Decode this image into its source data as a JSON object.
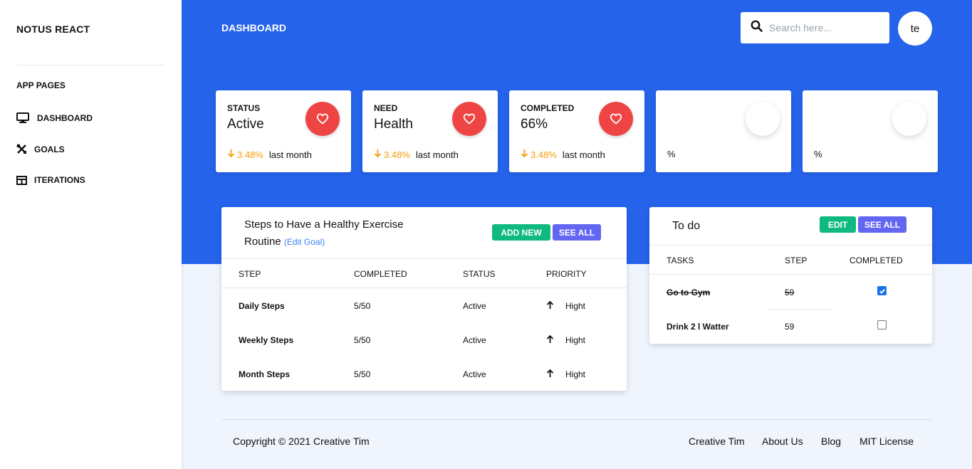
{
  "sidebar": {
    "brand": "NOTUS REACT",
    "heading": "APP PAGES",
    "items": [
      {
        "label": "DASHBOARD",
        "icon": "monitor-icon"
      },
      {
        "label": "GOALS",
        "icon": "tools-icon"
      },
      {
        "label": "ITERATIONS",
        "icon": "table-icon"
      }
    ]
  },
  "header": {
    "title": "DASHBOARD",
    "search_placeholder": "Search here...",
    "avatar_text": "te"
  },
  "stats": [
    {
      "label": "STATUS",
      "value": "Active",
      "change": "3.48%",
      "since": "last month",
      "icon": "heart-icon"
    },
    {
      "label": "NEED",
      "value": "Health",
      "change": "3.48%",
      "since": "last month",
      "icon": "heart-icon"
    },
    {
      "label": "COMPLETED",
      "value": "66%",
      "change": "3.48%",
      "since": "last month",
      "icon": "heart-icon"
    },
    {
      "footer": "%"
    },
    {
      "footer": "%"
    }
  ],
  "goal": {
    "title": "Steps to Have a Healthy Exercise Routine",
    "edit_link": "(Edit Goal)",
    "add_new": "ADD NEW",
    "see_all": "SEE ALL",
    "columns": [
      "STEP",
      "COMPLETED",
      "STATUS",
      "PRIORITY"
    ],
    "rows": [
      {
        "step": "Daily Steps",
        "completed": "5/50",
        "status": "Active",
        "priority": "Hight"
      },
      {
        "step": "Weekly Steps",
        "completed": "5/50",
        "status": "Active",
        "priority": "Hight"
      },
      {
        "step": "Month Steps",
        "completed": "5/50",
        "status": "Active",
        "priority": "Hight"
      }
    ]
  },
  "todo": {
    "title": "To do",
    "edit": "EDIT",
    "see_all": "SEE ALL",
    "columns": [
      "TASKS",
      "STEP",
      "COMPLETED"
    ],
    "rows": [
      {
        "task": "Go to Gym",
        "step": "59",
        "completed": true
      },
      {
        "task": "Drink 2 l Watter",
        "step": "59",
        "completed": false
      }
    ]
  },
  "footer": {
    "copyright": "Copyright © 2021 Creative Tim",
    "links": [
      "Creative Tim",
      "About Us",
      "Blog",
      "MIT License"
    ]
  },
  "colors": {
    "primary_blue": "#2563eb",
    "heart_red": "#ef4444",
    "trend_orange": "#f59e0b",
    "button_green": "#10b981",
    "button_indigo": "#6366f1"
  }
}
